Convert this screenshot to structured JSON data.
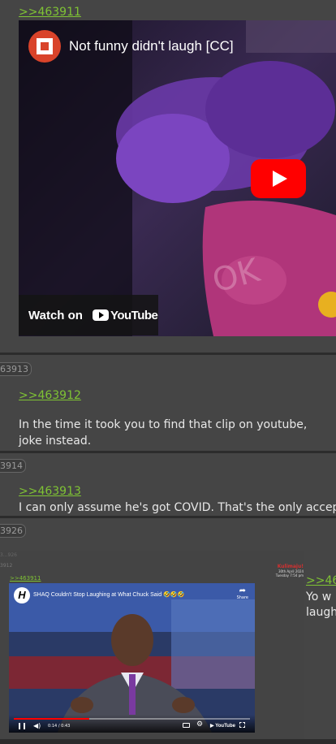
{
  "post1": {
    "quote": ">>463911",
    "video": {
      "title": "Not funny didn't laugh [CC]",
      "watch_on": "Watch on",
      "brand": "YouTube"
    }
  },
  "post2": {
    "number": "63913",
    "quote": ">>463912",
    "text_line1": "In the time it took you to find that clip on youtube, ",
    "text_line2": "joke instead."
  },
  "post3": {
    "number": "3914",
    "quote": ">>463913",
    "text": "I can only assume he's got COVID. That's the only accep"
  },
  "post4": {
    "number": "3926",
    "faint_number_1": "3...926",
    "faint_number_2": "3912",
    "screenshot_quote": ">>463911",
    "stamp_title": "Kulimaju!",
    "stamp_date": "30th April 2024",
    "stamp_time": "Tuesday 7:54 pm",
    "video": {
      "channel_letter": "H",
      "title": "SHAQ Couldn't Stop Laughing at What Chuck Said 🤣🤣🤣",
      "share": "Share",
      "time": "0:14 / 0:43",
      "brand": "YouTube"
    },
    "quote": ">>463",
    "text_line1": "Yo w",
    "text_line2": "laugh"
  }
}
